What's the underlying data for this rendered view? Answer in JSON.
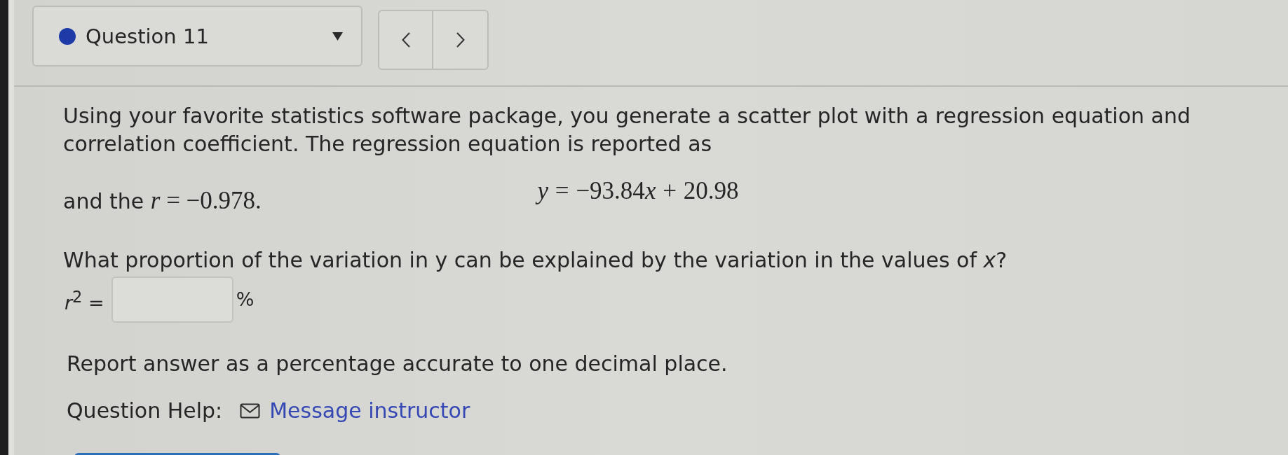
{
  "question_nav": {
    "label": "Question 11"
  },
  "question": {
    "paragraph": "Using your favorite statistics software package, you generate a scatter plot with a regression equation and correlation coefficient. The regression equation is reported as",
    "equation": [
      {
        "kind": "variable",
        "text": "y"
      },
      {
        "kind": "operator",
        "text": "="
      },
      {
        "kind": "number",
        "text": "−93.84"
      },
      {
        "kind": "variable",
        "text": "x"
      },
      {
        "kind": "operator",
        "text": "+"
      },
      {
        "kind": "number",
        "text": "20.98"
      }
    ],
    "correlation": {
      "lead": "and the",
      "math": "*r* = −0.978."
    },
    "prompt": "What proportion of the variation in y can be explained by the variation in the values of *x*?",
    "answer": {
      "label": "*r*$^{2}$ =",
      "unit": "%"
    },
    "instructions": "Report answer as a percentage accurate to one decimal place.",
    "help": {
      "label": "Question Help:",
      "link": "Message instructor"
    }
  }
}
